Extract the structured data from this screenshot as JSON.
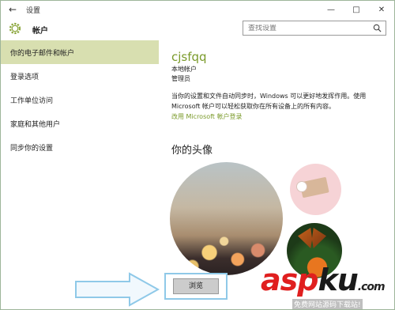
{
  "window": {
    "title": "设置",
    "back_icon": "back-arrow-icon",
    "controls": [
      "—",
      "□",
      "✕"
    ]
  },
  "header": {
    "title": "帐户",
    "search_placeholder": "查找设置"
  },
  "sidebar": {
    "items": [
      {
        "label": "你的电子邮件和帐户",
        "active": true
      },
      {
        "label": "登录选项",
        "active": false
      },
      {
        "label": "工作单位访问",
        "active": false
      },
      {
        "label": "家庭和其他用户",
        "active": false
      },
      {
        "label": "同步你的设置",
        "active": false
      }
    ]
  },
  "account": {
    "username": "cjsfqq",
    "type": "本地帐户",
    "role": "管理员",
    "description": "当你的设置和文件自动同步时，Windows 可以更好地发挥作用。使用 Microsoft 帐户可以轻松获取你在所有设备上的所有内容。",
    "ms_link": "改用 Microsoft 帐户登录"
  },
  "avatar": {
    "heading": "你的头像",
    "browse_label": "浏览"
  },
  "watermark": {
    "brand": "asp",
    "brand_tail": "ku",
    "tld": ".com",
    "subtitle": "免费网站源码下载站!"
  },
  "colors": {
    "accent": "#7a9a2a",
    "active_bg": "#d8dfb0",
    "highlight_border": "#8fc9e8"
  }
}
